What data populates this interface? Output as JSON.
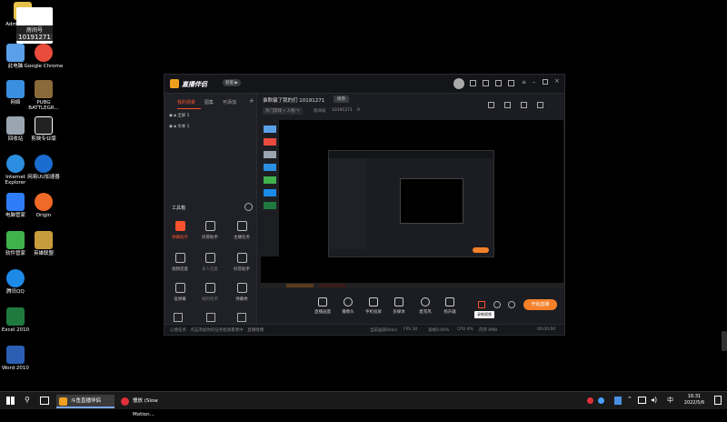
{
  "desktop": {
    "top_badge": {
      "line1": "房间号",
      "line2": "10191271"
    },
    "icons": [
      {
        "label": "Administrator",
        "color": "#e6c14a"
      },
      {
        "label": "此电脑",
        "color": "#5aa0e8"
      },
      {
        "label": "Google Chrome",
        "color": "#e94b3c"
      },
      {
        "label": "网络",
        "color": "#3b8fe0"
      },
      {
        "label": "PUBG BATTLEGR...",
        "color": "#8b6a3a"
      },
      {
        "label": "回收站",
        "color": "#9aa5b1"
      },
      {
        "label": "剪映专业版",
        "color": "#222222"
      },
      {
        "label": "Internet Explorer",
        "color": "#2c8ee0"
      },
      {
        "label": "网易UU加速器",
        "color": "#1a6ccf"
      },
      {
        "label": "电脑管家",
        "color": "#2f7df6"
      },
      {
        "label": "Origin",
        "color": "#f06a27"
      },
      {
        "label": "软件管家",
        "color": "#3fb24c"
      },
      {
        "label": "英雄联盟",
        "color": "#c89b3c"
      },
      {
        "label": "腾讯QQ",
        "color": "#1e8ae8"
      },
      {
        "label": "Excel 2010",
        "color": "#1f7a3f"
      },
      {
        "label": "Word 2010",
        "color": "#2b5fb4"
      }
    ]
  },
  "app": {
    "title": "直播伴侣",
    "version_badge": "新版 ▶",
    "left_tabs": [
      "我的场景",
      "图集",
      "可添加"
    ],
    "add_label": "+",
    "scenes": [
      "全屏 1",
      "文本 1"
    ],
    "tools_header": "工具箱",
    "tools": [
      {
        "label": "弹幕助手",
        "color": "#f5522d"
      },
      {
        "label": "房管助手",
        "color": "#bbbbbb"
      },
      {
        "label": "主播任务",
        "color": "#bbbbbb"
      },
      {
        "label": "视频连麦",
        "color": "#bbbbbb"
      },
      {
        "label": "多人连麦",
        "color": "#bbbbbb"
      },
      {
        "label": "抖音助手",
        "color": "#bbbbbb"
      },
      {
        "label": "设弹幕",
        "color": "#bbbbbb"
      },
      {
        "label": "福利抢单",
        "color": "#bbbbbb"
      },
      {
        "label": "弹幕秀",
        "color": "#bbbbbb"
      }
    ],
    "stream_title": "谁欺骗了我的们 10191271",
    "edit_label": "修改",
    "meta_tag1": "热门游戏 ∙ 人物 ✎",
    "meta_room": "房间号",
    "meta_room_num": "10191271",
    "meta_likes": "0",
    "bottom_tools": [
      "直播画面",
      "摄像头",
      "手机投屏",
      "多媒体",
      "麦克风",
      "扬声器"
    ],
    "start_label": "开始直播",
    "tooltip": "录制视频",
    "status_left": "心情任务 · 点击添加你的任务给观看者中 · 直播情绪",
    "status_stats": [
      "当前画质0kb/s",
      "FPS 30",
      "丢帧0.00%",
      "CPU 4%",
      "内存 0MB"
    ],
    "time_counter": "00:00:00"
  },
  "taskbar": {
    "items": [
      "斗鱼直播伴侣",
      "慢放 (Slow Motion..."
    ],
    "clock_time": "16:31",
    "clock_date": "2022/5/6",
    "lang": "中"
  }
}
